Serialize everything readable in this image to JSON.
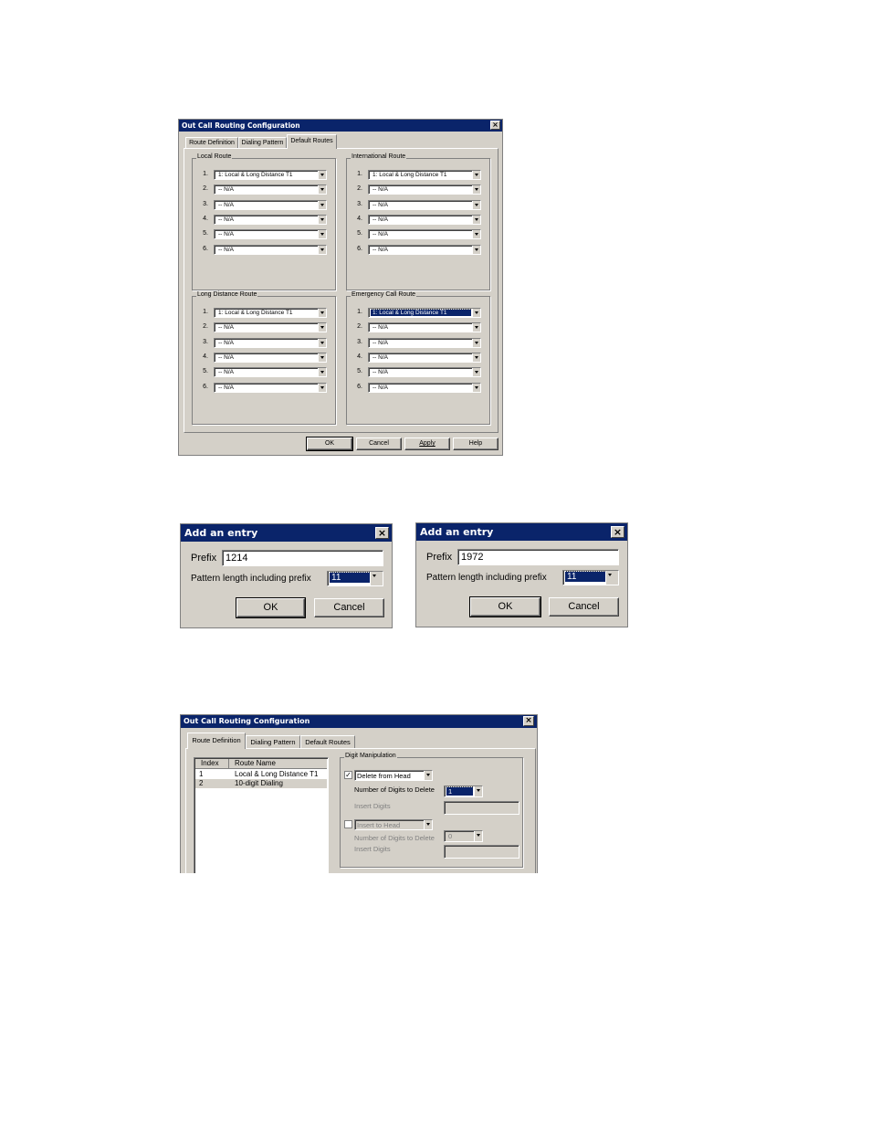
{
  "dialog1": {
    "title": "Out Call Routing Configuration",
    "tabs": [
      "Route Definition",
      "Dialing Pattern",
      "Default Routes"
    ],
    "groups": {
      "local": {
        "label": "Local Route",
        "rows": [
          {
            "n": "1.",
            "v": "1: Local & Long Distance T1"
          },
          {
            "n": "2.",
            "v": "-- N/A"
          },
          {
            "n": "3.",
            "v": "-- N/A"
          },
          {
            "n": "4.",
            "v": "-- N/A"
          },
          {
            "n": "5.",
            "v": "-- N/A"
          },
          {
            "n": "6.",
            "v": "-- N/A"
          }
        ]
      },
      "international": {
        "label": "International Route",
        "rows": [
          {
            "n": "1.",
            "v": "1: Local & Long Distance T1"
          },
          {
            "n": "2.",
            "v": "-- N/A"
          },
          {
            "n": "3.",
            "v": "-- N/A"
          },
          {
            "n": "4.",
            "v": "-- N/A"
          },
          {
            "n": "5.",
            "v": "-- N/A"
          },
          {
            "n": "6.",
            "v": "-- N/A"
          }
        ]
      },
      "longdistance": {
        "label": "Long Distance Route",
        "rows": [
          {
            "n": "1.",
            "v": "1: Local & Long Distance T1"
          },
          {
            "n": "2.",
            "v": "-- N/A"
          },
          {
            "n": "3.",
            "v": "-- N/A"
          },
          {
            "n": "4.",
            "v": "-- N/A"
          },
          {
            "n": "5.",
            "v": "-- N/A"
          },
          {
            "n": "6.",
            "v": "-- N/A"
          }
        ]
      },
      "emergency": {
        "label": "Emergency Call Route",
        "rows": [
          {
            "n": "1.",
            "v": "1: Local & Long Distance T1"
          },
          {
            "n": "2.",
            "v": "-- N/A"
          },
          {
            "n": "3.",
            "v": "-- N/A"
          },
          {
            "n": "4.",
            "v": "-- N/A"
          },
          {
            "n": "5.",
            "v": "-- N/A"
          },
          {
            "n": "6.",
            "v": "-- N/A"
          }
        ]
      }
    },
    "buttons": {
      "ok": "OK",
      "cancel": "Cancel",
      "apply": "Apply",
      "help": "Help"
    }
  },
  "entry1": {
    "title": "Add an entry",
    "prefix_label": "Prefix",
    "prefix_value": "1214",
    "pattern_label": "Pattern length including prefix",
    "pattern_value": "11",
    "ok": "OK",
    "cancel": "Cancel"
  },
  "entry2": {
    "title": "Add an entry",
    "prefix_label": "Prefix",
    "prefix_value": "1972",
    "pattern_label": "Pattern length including prefix",
    "pattern_value": "11",
    "ok": "OK",
    "cancel": "Cancel"
  },
  "dialog2": {
    "title": "Out Call Routing Configuration",
    "tabs": [
      "Route Definition",
      "Dialing Pattern",
      "Default Routes"
    ],
    "list_headers": [
      "Index",
      "Route Name"
    ],
    "list_rows": [
      {
        "index": "1",
        "name": "Local & Long Distance T1"
      },
      {
        "index": "2",
        "name": "10-digit Dialing"
      }
    ],
    "digit_group": "Digit Manipulation",
    "delete_option": "Delete from Head",
    "num_digits_label": "Number of Digits to Delete",
    "num_digits_value": "1",
    "insert_digits_label": "Insert Digits",
    "insert_option": "Insert to Head",
    "num_digits_label2": "Number of Digits to Delete",
    "num_digits_value2": "0",
    "insert_digits_label2": "Insert Digits"
  }
}
